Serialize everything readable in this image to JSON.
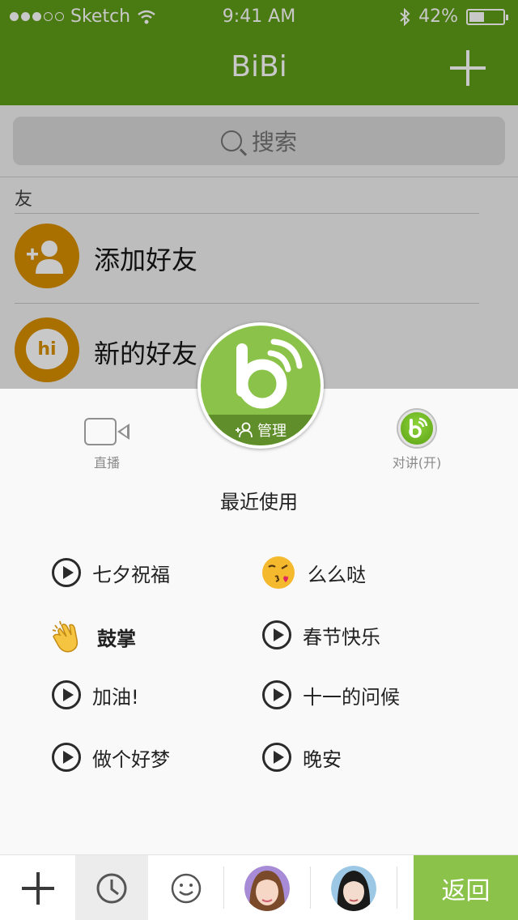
{
  "status_bar": {
    "carrier": "Sketch",
    "time": "9:41 AM",
    "battery": "42%"
  },
  "nav": {
    "title": "BiBi"
  },
  "search": {
    "placeholder": "搜索"
  },
  "friends": {
    "section_label": "友",
    "items": [
      {
        "label": "添加好友",
        "icon": "add-user-icon"
      },
      {
        "label": "新的好友",
        "icon": "hi-bubble-icon",
        "icon_text": "hi"
      }
    ]
  },
  "sheet": {
    "live_label": "直播",
    "talk_label": "对讲(开)",
    "manage_label": "管理",
    "recent_title": "最近使用",
    "phrases": [
      {
        "label": "七夕祝福",
        "icon": "play-icon"
      },
      {
        "label": "么么哒",
        "icon": "kiss-emoji-icon"
      },
      {
        "label": "鼓掌",
        "icon": "clap-emoji-icon"
      },
      {
        "label": "春节快乐",
        "icon": "play-icon"
      },
      {
        "label": "加油!",
        "icon": "play-icon"
      },
      {
        "label": "十一的问候",
        "icon": "play-icon"
      },
      {
        "label": "做个好梦",
        "icon": "play-icon"
      },
      {
        "label": "晚安",
        "icon": "play-icon"
      }
    ]
  },
  "toolbar": {
    "return_label": "返回"
  },
  "colors": {
    "brand_green": "#8bc34a",
    "nav_dimmed": "#4a7a12",
    "manage_band": "#5f8e2a",
    "orange_dimmed": "#a97000"
  }
}
